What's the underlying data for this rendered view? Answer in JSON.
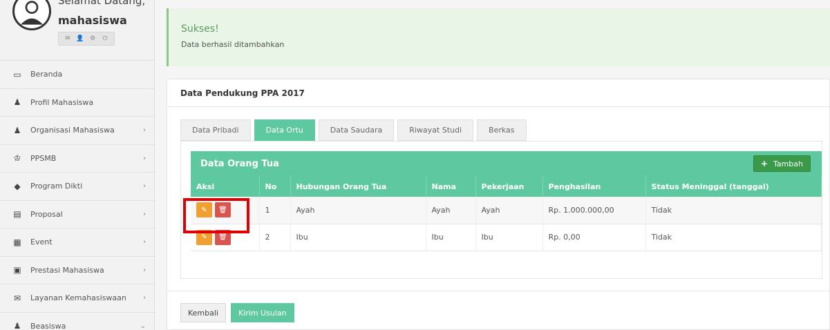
{
  "sidebar": {
    "welcome_text": "Selamat Datang,",
    "username": "mahasiswa",
    "user_icons": [
      "envelope-icon",
      "user-icon",
      "gear-icon",
      "power-icon"
    ],
    "items": [
      {
        "label": "Beranda",
        "icon": "monitor-icon",
        "chevron": ""
      },
      {
        "label": "Profil Mahasiswa",
        "icon": "user-icon",
        "chevron": ""
      },
      {
        "label": "Organisasi Mahasiswa",
        "icon": "users-icon",
        "chevron": "›"
      },
      {
        "label": "PPSMB",
        "icon": "trophy-icon",
        "chevron": "›"
      },
      {
        "label": "Program Dikti",
        "icon": "tag-icon",
        "chevron": "›"
      },
      {
        "label": "Proposal",
        "icon": "file-icon",
        "chevron": "›"
      },
      {
        "label": "Event",
        "icon": "calendar-icon",
        "chevron": "›"
      },
      {
        "label": "Prestasi Mahasiswa",
        "icon": "gift-icon",
        "chevron": "›"
      },
      {
        "label": "Layanan Kemahasiswaan",
        "icon": "envelope-icon",
        "chevron": "›"
      },
      {
        "label": "Beasiswa",
        "icon": "users-icon",
        "chevron": "⌄"
      }
    ]
  },
  "alert": {
    "title": "Sukses!",
    "message": "Data berhasil ditambahkan"
  },
  "panel": {
    "title": "Data Pendukung PPA 2017",
    "tabs": [
      {
        "label": "Data Pribadi",
        "active": false
      },
      {
        "label": "Data Ortu",
        "active": true
      },
      {
        "label": "Data Saudara",
        "active": false
      },
      {
        "label": "Riwayat Studi",
        "active": false
      },
      {
        "label": "Berkas",
        "active": false
      }
    ],
    "box_title": "Data Orang Tua",
    "add_button": "Tambah",
    "columns": [
      "Aksi",
      "No",
      "Hubungan Orang Tua",
      "Nama",
      "Pekerjaan",
      "Penghasilan",
      "Status Meninggal (tanggal)"
    ],
    "rows": [
      {
        "no": "1",
        "hubungan": "Ayah",
        "nama": "Ayah",
        "pekerjaan": "Ayah",
        "penghasilan": "Rp. 1.000.000,00",
        "status": "Tidak"
      },
      {
        "no": "2",
        "hubungan": "Ibu",
        "nama": "Ibu",
        "pekerjaan": "Ibu",
        "penghasilan": "Rp. 0,00",
        "status": "Tidak"
      }
    ],
    "back_button": "Kembali",
    "submit_button": "Kirim Usulan"
  },
  "colors": {
    "accent": "#5ec9a0",
    "success_bg": "#e9f5e6",
    "edit": "#f0a030",
    "delete": "#d9534f",
    "highlight": "#e00000"
  }
}
